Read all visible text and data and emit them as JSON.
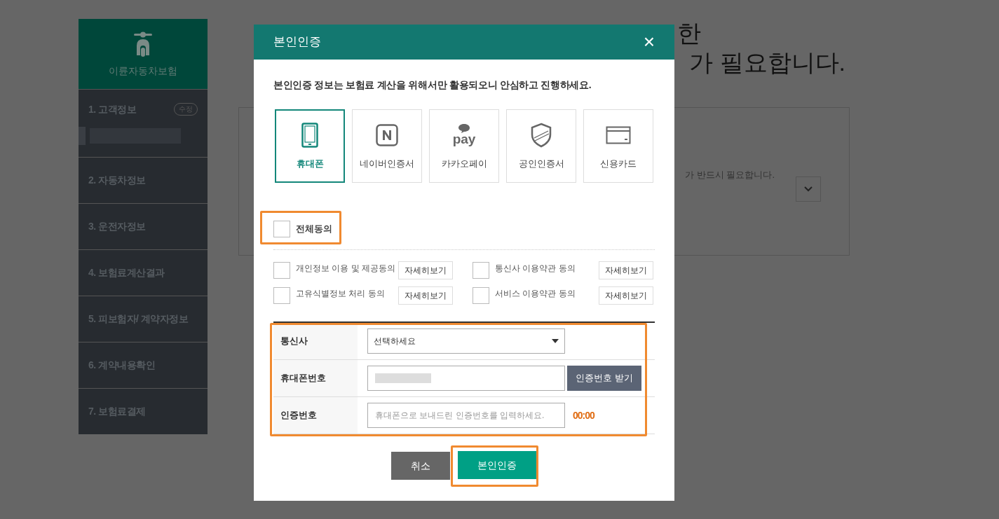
{
  "page": {
    "heading_line_1": "한",
    "heading_line_2": "가 필요합니다.",
    "notice_fragment": "가 반드시 필요합니다."
  },
  "sidebar": {
    "brand": "이륜자동차보험",
    "steps": [
      {
        "label": "1. 고객정보",
        "badge": "수정",
        "redacted": true
      },
      {
        "label": "2. 자동차정보"
      },
      {
        "label": "3. 운전자정보"
      },
      {
        "label": "4. 보험료계산결과"
      },
      {
        "label": "5. 피보험자/ 계약자정보"
      },
      {
        "label": "6. 계약내용확인"
      },
      {
        "label": "7. 보험료결제"
      }
    ]
  },
  "modal": {
    "title": "본인인증",
    "close": "×",
    "intro": "본인인증 정보는 보험료 계산을 위해서만 활용되오니 안심하고 진행하세요.",
    "methods": [
      {
        "kind": "phone",
        "label": "휴대폰",
        "selected": true
      },
      {
        "kind": "naver",
        "label": "네이버인증서",
        "selected": false
      },
      {
        "kind": "kakaopay",
        "label": "카카오페이",
        "icon_text": "pay",
        "selected": false
      },
      {
        "kind": "certificate",
        "label": "공인인증서",
        "selected": false
      },
      {
        "kind": "card",
        "label": "신용카드",
        "selected": false
      }
    ],
    "agree_all": {
      "label": "전체동의",
      "checked": false
    },
    "consents": [
      {
        "label": "개인정보 이용 및 제공동의",
        "checked": false,
        "button": "자세히보기"
      },
      {
        "label": "통신사 이용약관 동의",
        "checked": false,
        "button": "자세히보기"
      },
      {
        "label": "고유식별정보 처리 동의",
        "checked": false,
        "button": "자세히보기"
      },
      {
        "label": "서비스 이용약관 동의",
        "checked": false,
        "button": "자세히보기"
      }
    ],
    "form": {
      "carrier": {
        "label": "통신사",
        "value": "선택하세요"
      },
      "phone": {
        "label": "휴대폰번호",
        "redacted": true,
        "button": "인증번호 받기"
      },
      "code": {
        "label": "인증번호",
        "placeholder": "휴대폰으로 보내드린 인증번호를 입력하세요.",
        "timer": "00:00"
      }
    },
    "buttons": {
      "cancel": "취소",
      "confirm": "본인인증"
    }
  }
}
